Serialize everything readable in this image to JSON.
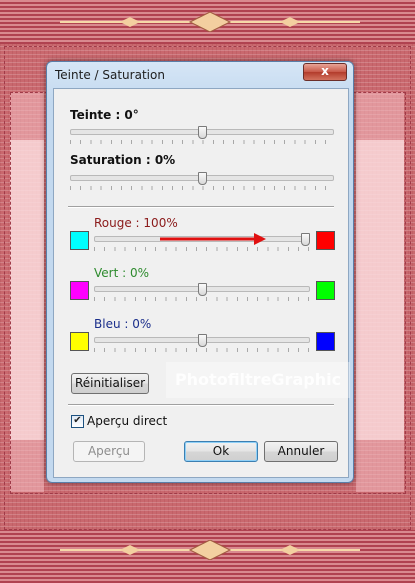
{
  "dialog": {
    "title": "Teinte / Saturation",
    "close_glyph": "x",
    "hue_label": "Teinte : 0°",
    "saturation_label": "Saturation : 0%",
    "hue_value": 0,
    "saturation_value": 0,
    "red": {
      "label": "Rouge : 100%",
      "value": 100,
      "label_color": "#8b1a1a",
      "left_color": "#00ffff",
      "right_color": "#ff0000"
    },
    "green": {
      "label": "Vert : 0%",
      "value": 0,
      "label_color": "#2e8b2e",
      "left_color": "#ff00ff",
      "right_color": "#00ff00"
    },
    "blue": {
      "label": "Bleu : 0%",
      "value": 0,
      "label_color": "#1a2e8b",
      "left_color": "#ffff00",
      "right_color": "#0000ff"
    },
    "reset_label": "Réinitialiser",
    "preview_check_label": "Aperçu direct",
    "preview_checked": true,
    "preview_button": "Aperçu",
    "ok_button": "Ok",
    "cancel_button": "Annuler"
  },
  "watermark": "PhotofiltreGraphic",
  "colors": {
    "arrow": "#e01010",
    "background": "#c9686e"
  }
}
